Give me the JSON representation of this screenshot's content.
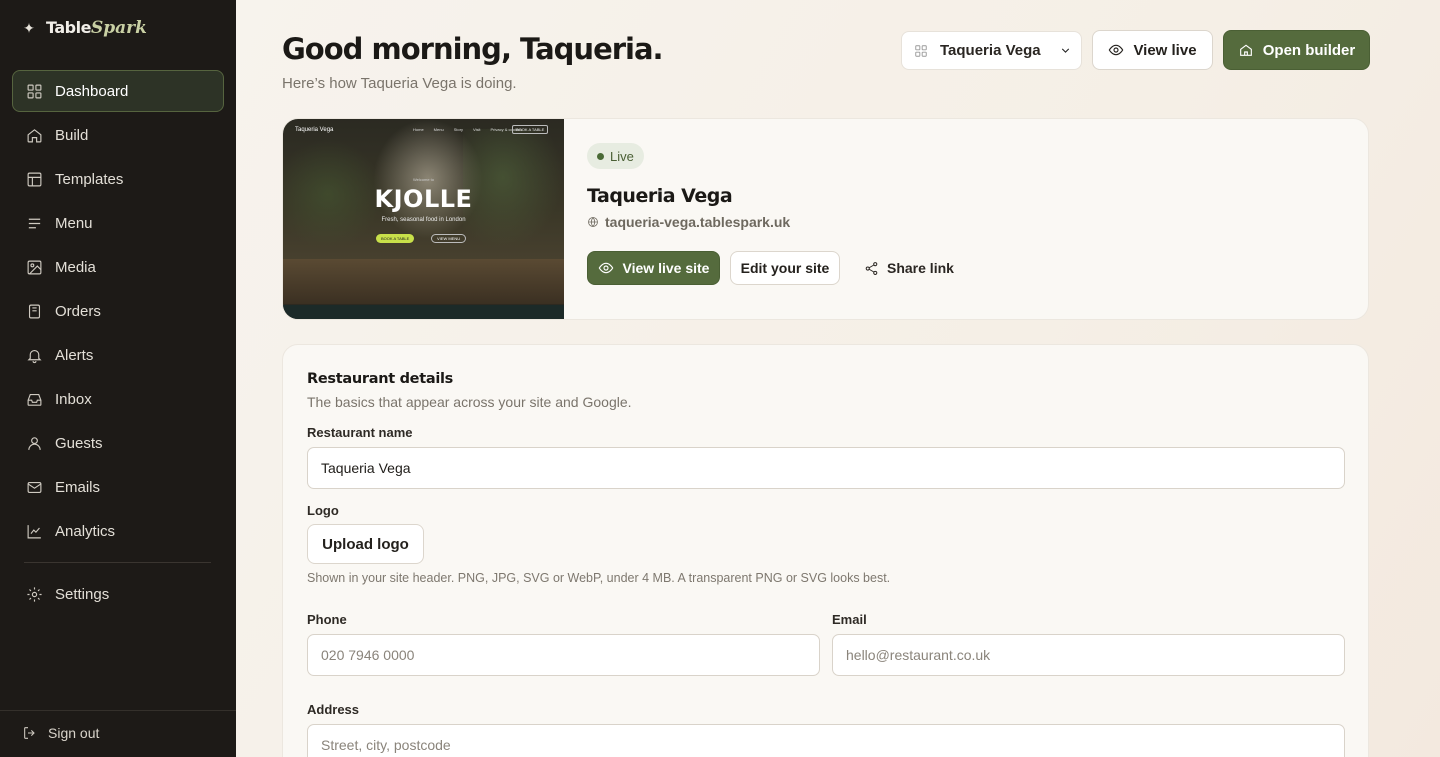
{
  "brand": {
    "word1": "Table",
    "word2": "Spark"
  },
  "nav": {
    "items": [
      {
        "label": "Dashboard"
      },
      {
        "label": "Build"
      },
      {
        "label": "Templates"
      },
      {
        "label": "Menu"
      },
      {
        "label": "Media"
      },
      {
        "label": "Orders"
      },
      {
        "label": "Alerts"
      },
      {
        "label": "Inbox"
      },
      {
        "label": "Guests"
      },
      {
        "label": "Emails"
      },
      {
        "label": "Analytics"
      }
    ],
    "settings": "Settings",
    "signout": "Sign out"
  },
  "header": {
    "greeting": "Good morning, Taqueria.",
    "subtitle": "Here’s how Taqueria Vega is doing.",
    "site_select": "Taqueria Vega",
    "view_live": "View live",
    "open_builder": "Open builder"
  },
  "site_card": {
    "status": "Live",
    "name": "Taqueria Vega",
    "url": "taqueria-vega.tablespark.uk",
    "view_live_site": "View live site",
    "edit_site": "Edit your site",
    "share_link": "Share link",
    "preview": {
      "brand": "Taqueria Vega",
      "nav": [
        "Home",
        "Menu",
        "Story",
        "Visit",
        "Privacy & cookies"
      ],
      "book": "BOOK A TABLE",
      "welcome": "Welcome to",
      "hero": "KJOLLE",
      "tagline": "Fresh, seasonal food in London",
      "btn1": "BOOK A TABLE",
      "btn2": "VIEW MENU"
    }
  },
  "details": {
    "title": "Restaurant details",
    "subtitle": "The basics that appear across your site and Google.",
    "name_label": "Restaurant name",
    "name_value": "Taqueria Vega",
    "logo_label": "Logo",
    "upload_logo": "Upload logo",
    "logo_hint": "Shown in your site header. PNG, JPG, SVG or WebP, under 4 MB. A transparent PNG or SVG looks best.",
    "phone_label": "Phone",
    "phone_placeholder": "020 7946 0000",
    "email_label": "Email",
    "email_placeholder": "hello@restaurant.co.uk",
    "address_label": "Address",
    "address_placeholder": "Street, city, postcode"
  },
  "colors": {
    "accent": "#556b3d",
    "sidebar": "#1d1a17",
    "active_nav": "#2d3326"
  }
}
